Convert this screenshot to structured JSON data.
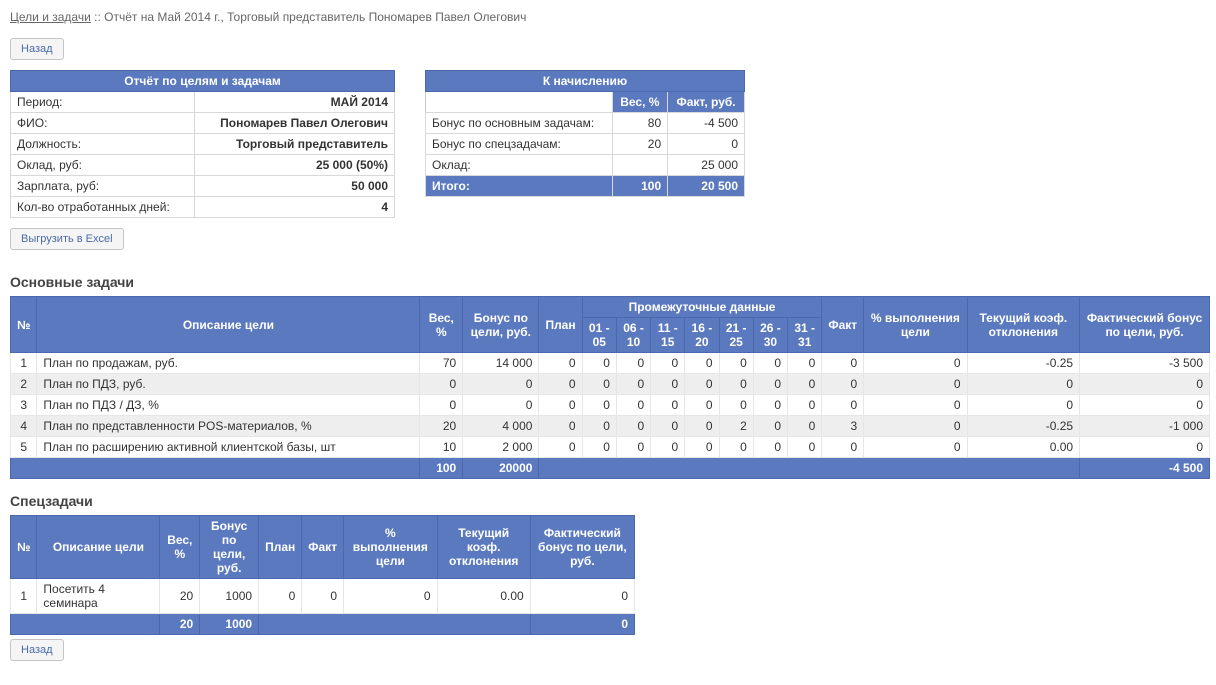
{
  "breadcrumb": {
    "link_text": "Цели и задачи",
    "tail": " :: Отчёт на Май 2014 г., Торговый представитель Пономарев Павел Олегович"
  },
  "buttons": {
    "back": "Назад",
    "export": "Выгрузить в Excel"
  },
  "info_box": {
    "title": "Отчёт по целям и задачам",
    "rows": [
      {
        "label": "Период:",
        "value": "МАЙ 2014"
      },
      {
        "label": "ФИО:",
        "value": "Пономарев Павел Олегович"
      },
      {
        "label": "Должность:",
        "value": "Торговый представитель"
      },
      {
        "label": "Оклад, руб:",
        "value": "25 000 (50%)"
      },
      {
        "label": "Зарплата, руб:",
        "value": "50 000"
      },
      {
        "label": "Кол-во отработанных дней:",
        "value": "4"
      }
    ]
  },
  "payout_box": {
    "title": "К начислению",
    "col_weight": "Вес, %",
    "col_fact": "Факт, руб.",
    "rows": [
      {
        "label": "Бонус по основным задачам:",
        "weight": "80",
        "fact": "-4 500"
      },
      {
        "label": "Бонус по спецзадачам:",
        "weight": "20",
        "fact": "0"
      },
      {
        "label": "Оклад:",
        "weight": "",
        "fact": "25 000"
      }
    ],
    "total": {
      "label": "Итого:",
      "weight": "100",
      "fact": "20 500"
    }
  },
  "main_section": {
    "title": "Основные задачи",
    "headers": {
      "num": "№",
      "desc": "Описание цели",
      "weight": "Вес, %",
      "bonus_goal": "Бонус по цели, руб.",
      "plan": "План",
      "interim_group": "Промежуточные данные",
      "interim_cols": [
        "01 - 05",
        "06 - 10",
        "11 - 15",
        "16 - 20",
        "21 - 25",
        "26 - 30",
        "31 - 31"
      ],
      "fact": "Факт",
      "pct_exec": "% выполнения цели",
      "coef_dev": "Текущий коэф. отклонения",
      "fact_bonus": "Фактический бонус по цели, руб."
    },
    "rows": [
      {
        "n": "1",
        "desc": "План по продажам, руб.",
        "w": "70",
        "bg": "14 000",
        "plan": "0",
        "d": [
          "0",
          "0",
          "0",
          "0",
          "0",
          "0",
          "0"
        ],
        "fact": "0",
        "pct": "0",
        "coef": "-0.25",
        "fb": "-3 500"
      },
      {
        "n": "2",
        "desc": "План по ПДЗ, руб.",
        "w": "0",
        "bg": "0",
        "plan": "0",
        "d": [
          "0",
          "0",
          "0",
          "0",
          "0",
          "0",
          "0"
        ],
        "fact": "0",
        "pct": "0",
        "coef": "0",
        "fb": "0"
      },
      {
        "n": "3",
        "desc": "План по ПДЗ / ДЗ, %",
        "w": "0",
        "bg": "0",
        "plan": "0",
        "d": [
          "0",
          "0",
          "0",
          "0",
          "0",
          "0",
          "0"
        ],
        "fact": "0",
        "pct": "0",
        "coef": "0",
        "fb": "0"
      },
      {
        "n": "4",
        "desc": "План по представленности POS-материалов, %",
        "w": "20",
        "bg": "4 000",
        "plan": "0",
        "d": [
          "0",
          "0",
          "0",
          "0",
          "2",
          "0",
          "0"
        ],
        "fact": "3",
        "pct": "0",
        "coef": "-0.25",
        "fb": "-1 000"
      },
      {
        "n": "5",
        "desc": "План по расширению активной клиентской базы, шт",
        "w": "10",
        "bg": "2 000",
        "plan": "0",
        "d": [
          "0",
          "0",
          "0",
          "0",
          "0",
          "0",
          "0"
        ],
        "fact": "0",
        "pct": "0",
        "coef": "0.00",
        "fb": "0"
      }
    ],
    "totals": {
      "w": "100",
      "bg": "20000",
      "fb": "-4 500"
    }
  },
  "spec_section": {
    "title": "Спецзадачи",
    "headers": {
      "num": "№",
      "desc": "Описание цели",
      "weight": "Вес, %",
      "bonus_goal": "Бонус по цели, руб.",
      "plan": "План",
      "fact": "Факт",
      "pct_exec": "% выполнения цели",
      "coef_dev": "Текущий коэф. отклонения",
      "fact_bonus": "Фактический бонус по цели, руб."
    },
    "rows": [
      {
        "n": "1",
        "desc": "Посетить 4 семинара",
        "w": "20",
        "bg": "1000",
        "plan": "0",
        "fact": "0",
        "pct": "0",
        "coef": "0.00",
        "fb": "0"
      }
    ],
    "totals": {
      "w": "20",
      "bg": "1000",
      "fb": "0"
    }
  }
}
